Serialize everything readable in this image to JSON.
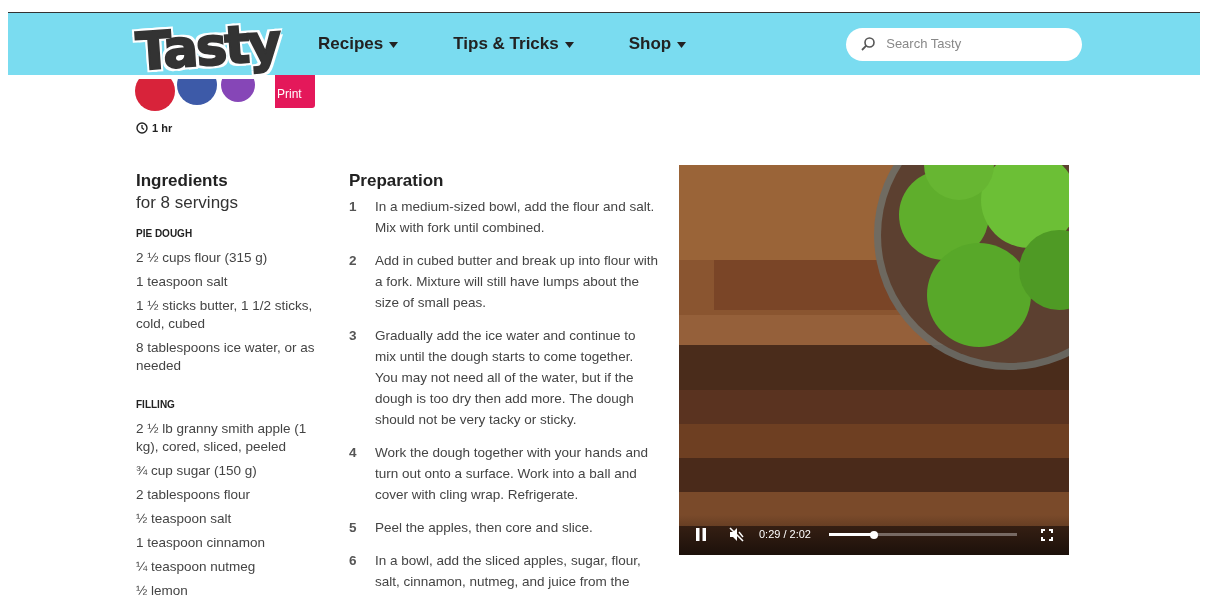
{
  "header": {
    "logo": "Tasty",
    "nav": [
      {
        "label": "Recipes"
      },
      {
        "label": "Tips & Tricks"
      },
      {
        "label": "Shop"
      }
    ],
    "search": {
      "placeholder": "Search Tasty"
    }
  },
  "print_button": "Print",
  "time": "1 hr",
  "ingredients": {
    "title": "Ingredients",
    "servings": "for 8 servings",
    "sections": [
      {
        "heading": "PIE DOUGH",
        "items": [
          "2 ½ cups flour (315 g)",
          "1 teaspoon salt",
          "1 ½ sticks butter, 1 1/2 sticks, cold, cubed",
          "8 tablespoons ice water, or as needed"
        ]
      },
      {
        "heading": "FILLING",
        "items": [
          "2 ½ lb granny smith apple (1 kg), cored, sliced, peeled",
          "¾ cup sugar (150 g)",
          "2 tablespoons flour",
          "½ teaspoon salt",
          "1 teaspoon cinnamon",
          "¼ teaspoon nutmeg",
          "½ lemon"
        ]
      }
    ]
  },
  "preparation": {
    "title": "Preparation",
    "steps": [
      {
        "number": "1",
        "text": "In a medium-sized bowl, add the flour and salt. Mix with fork until combined."
      },
      {
        "number": "2",
        "text": "Add in cubed butter and break up into flour with a fork. Mixture will still have lumps about the size of small peas."
      },
      {
        "number": "3",
        "text": "Gradually add the ice water and continue to mix until the dough starts to come together. You may not need all of the water, but if the dough is too dry then add more. The dough should not be very tacky or sticky."
      },
      {
        "number": "4",
        "text": "Work the dough together with your hands and turn out onto a surface. Work into a ball and cover with cling wrap. Refrigerate."
      },
      {
        "number": "5",
        "text": "Peel the apples, then core and slice."
      },
      {
        "number": "6",
        "text": "In a bowl, add the sliced apples, sugar, flour, salt, cinnamon, nutmeg, and juice from the"
      }
    ]
  },
  "video": {
    "kind": "picture",
    "playing": true,
    "muted": true,
    "time": "0:29 / 2:02",
    "level": 0.24
  }
}
